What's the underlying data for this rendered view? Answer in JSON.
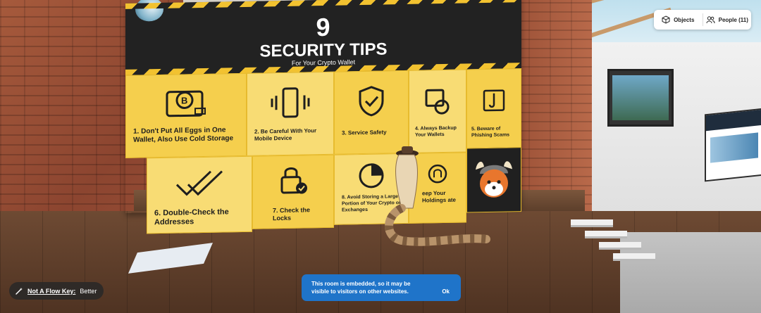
{
  "toolbar": {
    "objects_label": "Objects",
    "people_label": "People (11)"
  },
  "poster": {
    "number": "9",
    "title": "SECURITY TIPS",
    "subtitle": "For Your Crypto Wallet",
    "tips": [
      "1. Don't Put All Eggs in One Wallet, Also Use Cold Storage",
      "2. Be Careful With Your Mobile Device",
      "3. Service Safety",
      "4. Always Backup Your Wallets",
      "5. Beware of Phishing Scams",
      "6. Double-Check the Addresses",
      "7. Check the Locks",
      "8. Avoid Storing a Large Portion of Your Crypto on Exchanges",
      "eep Your Holdings ate"
    ]
  },
  "flow_chip": {
    "key_label": "Not A Flow Key:",
    "value": "Better"
  },
  "toast": {
    "message": "This room is embedded, so it may be visible to visitors on other websites.",
    "ok_label": "Ok"
  },
  "icons": [
    "cube-icon",
    "people-icon",
    "wand-icon",
    "bitcoin-wallet-icon",
    "phone-icon",
    "shield-check-icon",
    "backup-icon",
    "phishing-hook-icon",
    "double-check-icon",
    "padlock-icon",
    "pie-icon",
    "fingerprint-icon",
    "viking-shiba-icon"
  ],
  "colors": {
    "poster_yellow": "#f5cf4d",
    "poster_dark": "#222222",
    "toast_blue": "#1f74c9"
  }
}
